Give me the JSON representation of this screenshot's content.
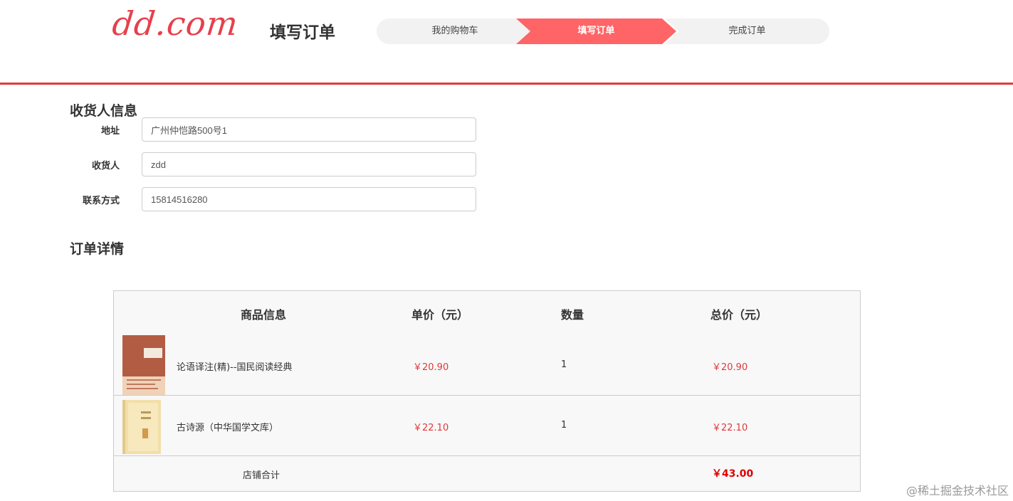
{
  "header": {
    "logo": "dd.com",
    "title": "填写订单",
    "steps": [
      "我的购物车",
      "填写订单",
      "完成订单"
    ]
  },
  "receiver": {
    "title": "收货人信息",
    "address_label": "地址",
    "address_value": "广州仲恺路500号1",
    "name_label": "收货人",
    "name_value": "zdd",
    "phone_label": "联系方式",
    "phone_value": "15814516280"
  },
  "order": {
    "title": "订单详情",
    "columns": [
      "商品信息",
      "单价（元）",
      "数量",
      "总价（元）"
    ],
    "items": [
      {
        "name": "论语译注(精)--国民阅读经典",
        "price": "￥20.90",
        "qty": "1",
        "total": "￥20.90"
      },
      {
        "name": "古诗源（中华国学文库）",
        "price": "￥22.10",
        "qty": "1",
        "total": "￥22.10"
      }
    ],
    "sum_label": "店铺合计",
    "sum_value": "￥43.00"
  },
  "watermark": "@稀土掘金技术社区",
  "colors": {
    "accent": "#ff6466",
    "divider": "#e03c3c",
    "price": "#e0383a"
  }
}
